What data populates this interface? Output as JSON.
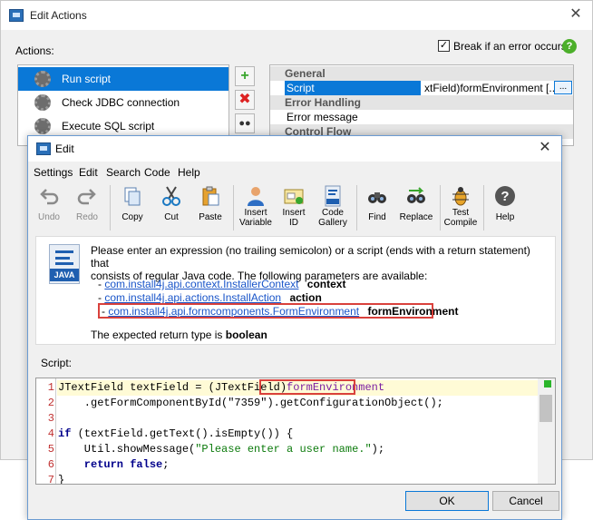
{
  "back_window": {
    "title": "Edit Actions",
    "close": "✕",
    "actions_label": "Actions:",
    "break_checkbox": "✓",
    "break_label": "Break if an error occurs",
    "help": "?",
    "actions": [
      "Run script",
      "Check JDBC connection",
      "Execute SQL script"
    ],
    "side_buttons": {
      "add": "+",
      "delete": "✖",
      "find": "●●"
    },
    "properties": {
      "general": "General",
      "script_key": "Script",
      "script_value": "xtField)formEnvironment [...]",
      "ellipsis": "...",
      "error_handling": "Error Handling",
      "error_message": "Error message",
      "control_flow": "Control Flow"
    }
  },
  "dialog": {
    "title": "Edit",
    "close": "✕",
    "menu": [
      "Settings",
      "Edit",
      "Search",
      "Code",
      "Help"
    ],
    "toolbar": {
      "undo": "Undo",
      "redo": "Redo",
      "copy": "Copy",
      "cut": "Cut",
      "paste": "Paste",
      "insert_variable_1": "Insert",
      "insert_variable_2": "Variable",
      "insert_id_1": "Insert",
      "insert_id_2": "ID",
      "code_gallery_1": "Code",
      "code_gallery_2": "Gallery",
      "find": "Find",
      "replace": "Replace",
      "test_compile_1": "Test",
      "test_compile_2": "Compile",
      "help": "Help"
    },
    "info": {
      "java_badge": "JAVA",
      "line1": "Please enter an expression (no trailing semicolon) or a script (ends with a return statement) that",
      "line2": "consists of regular Java code. The following parameters are available:",
      "params": [
        {
          "class": "com.install4j.api.context.InstallerContext",
          "name": "context"
        },
        {
          "class": "com.install4j.api.actions.InstallAction",
          "name": "action"
        },
        {
          "class": "com.install4j.api.formcomponents.FormEnvironment",
          "name": "formEnvironment"
        }
      ],
      "param_dash": "-",
      "return_prefix": "The expected return type is",
      "return_type": "boolean"
    },
    "script_label": "Script:",
    "code": {
      "line_numbers": [
        "1",
        "2",
        "3",
        "4",
        "5",
        "6",
        "7"
      ],
      "l1_type": "JTextField textField = (JTextField)",
      "l1_param": "formEnvironment",
      "l2": "    .getFormComponentById(\"7359\").getConfigurationObject();",
      "l4_kw": "if",
      "l4_rest": " (textField.getText().isEmpty()) {",
      "l5_a": "    Util.showMessage(",
      "l5_str": "\"Please enter a user name.\"",
      "l5_b": ");",
      "l6_kw": "    return false",
      "l6_end": ";",
      "l7": "}"
    },
    "ok": "OK",
    "cancel": "Cancel"
  }
}
